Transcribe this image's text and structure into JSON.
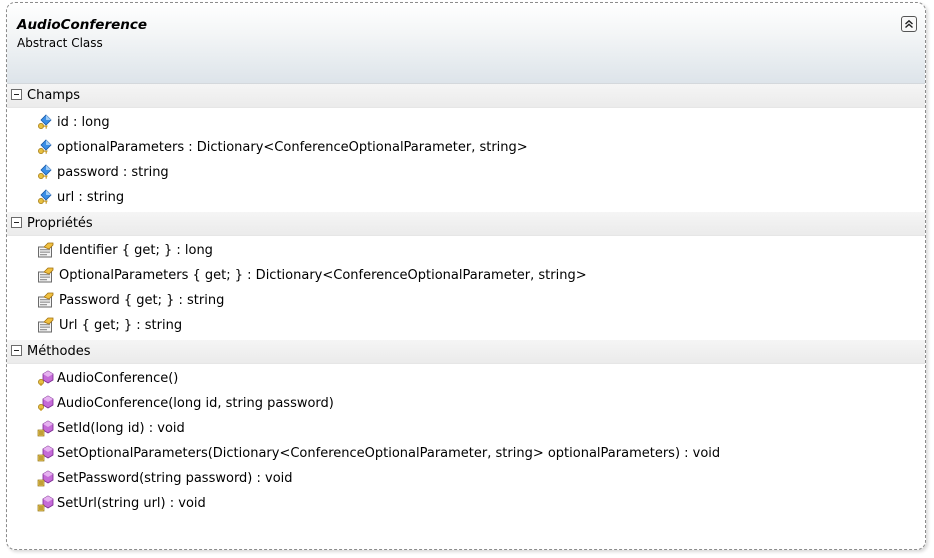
{
  "class": {
    "name": "AudioConference",
    "stereotype": "Abstract Class"
  },
  "icons": {
    "field": "private-field-icon",
    "property": "property-icon",
    "method": "method-icon"
  },
  "sections": {
    "fields": {
      "title": "Champs",
      "items": [
        "id : long",
        "optionalParameters : Dictionary<ConferenceOptionalParameter, string>",
        "password : string",
        "url : string"
      ]
    },
    "properties": {
      "title": "Propriétés",
      "items": [
        "Identifier { get; } : long",
        "OptionalParameters { get; } : Dictionary<ConferenceOptionalParameter, string>",
        "Password { get; } : string",
        "Url { get; } : string"
      ]
    },
    "methods": {
      "title": "Méthodes",
      "items": [
        "AudioConference()",
        "AudioConference(long id, string password)",
        "SetId(long id) : void",
        "SetOptionalParameters(Dictionary<ConferenceOptionalParameter, string> optionalParameters) : void",
        "SetPassword(string password) : void",
        "SetUrl(string url) : void"
      ]
    }
  }
}
